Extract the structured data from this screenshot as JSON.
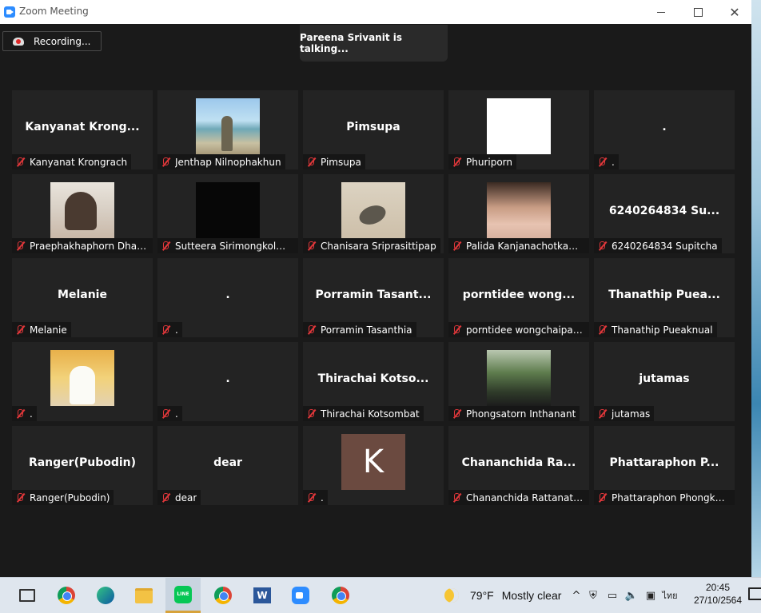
{
  "window": {
    "title": "Zoom Meeting"
  },
  "recording": {
    "label": "Recording..."
  },
  "active_speaker": {
    "text": "Pareena Srivanit is talking..."
  },
  "participants": [
    {
      "display": "Kanyanat  Krong...",
      "name": "Kanyanat Krongrach",
      "type": "name"
    },
    {
      "display": "",
      "name": "Jenthap Nilnophakhun",
      "type": "photo-beach"
    },
    {
      "display": "Pimsupa",
      "name": "Pimsupa",
      "type": "name"
    },
    {
      "display": "",
      "name": "Phuriporn",
      "type": "photo-white"
    },
    {
      "display": ".",
      "name": ".",
      "type": "name"
    },
    {
      "display": "",
      "name": "Praephakhaphorn Dhan...",
      "type": "photo-girl"
    },
    {
      "display": "",
      "name": "Sutteera Sirimongkolmu...",
      "type": "photo-dark"
    },
    {
      "display": "",
      "name": "Chanisara Sriprasittipap",
      "type": "photo-sand"
    },
    {
      "display": "",
      "name": "Palida Kanjanachotkamol",
      "type": "photo-face"
    },
    {
      "display": "6240264834 Su...",
      "name": "6240264834 Supitcha",
      "type": "name"
    },
    {
      "display": "Melanie",
      "name": "Melanie",
      "type": "name"
    },
    {
      "display": ".",
      "name": ".",
      "type": "name"
    },
    {
      "display": "Porramin  Tasant...",
      "name": "Porramin Tasanthia",
      "type": "name"
    },
    {
      "display": "porntidee  wong...",
      "name": "porntidee wongchaipani...",
      "type": "name"
    },
    {
      "display": "Thanathip  Puea...",
      "name": "Thanathip Pueaknual",
      "type": "name"
    },
    {
      "display": "",
      "name": ".",
      "type": "photo-boy"
    },
    {
      "display": ".",
      "name": ".",
      "type": "name"
    },
    {
      "display": "Thirachai  Kotso...",
      "name": "Thirachai Kotsombat",
      "type": "name"
    },
    {
      "display": "",
      "name": "Phongsatorn Inthanant",
      "type": "photo-tree"
    },
    {
      "display": "jutamas",
      "name": "jutamas",
      "type": "name"
    },
    {
      "display": "Ranger(Pubodin)",
      "name": "Ranger(Pubodin)",
      "type": "name"
    },
    {
      "display": "dear",
      "name": "dear",
      "type": "name"
    },
    {
      "display": "K",
      "name": ".",
      "type": "letter"
    },
    {
      "display": "Chananchida  Ra...",
      "name": "Chananchida Rattanathon",
      "type": "name"
    },
    {
      "display": "Phattaraphon  P...",
      "name": "Phattaraphon Phongkhan",
      "type": "name"
    }
  ],
  "taskbar": {
    "line_label": "LINE",
    "word_label": "W",
    "weather": {
      "temp": "79°F",
      "condition": "Mostly clear"
    },
    "language": "ไทย",
    "time": "20:45",
    "date": "27/10/2564"
  },
  "colors": {
    "muted_mic": "#e0373a",
    "accent": "#2d8cff"
  }
}
